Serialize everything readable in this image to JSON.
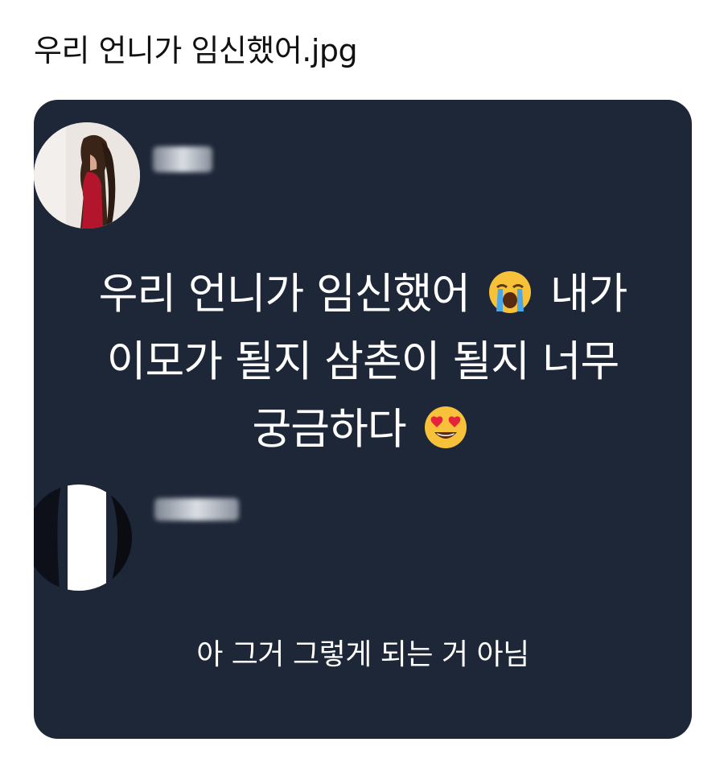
{
  "page": {
    "title": "우리 언니가 임신했어.jpg"
  },
  "post": {
    "line1_before": "우리 언니가 임신했어",
    "line1_emoji": "loudly-crying-face-icon",
    "line1_after": "내가",
    "line2": "이모가 될지 삼촌이 될지 너무",
    "line3_before": "궁금하다",
    "line3_emoji": "heart-eyes-face-icon"
  },
  "reply": {
    "text": "아 그거 그렇게 되는 거 아님"
  },
  "colors": {
    "card_background": "#1d2738",
    "text": "#ffffff",
    "page_background": "#ffffff"
  }
}
